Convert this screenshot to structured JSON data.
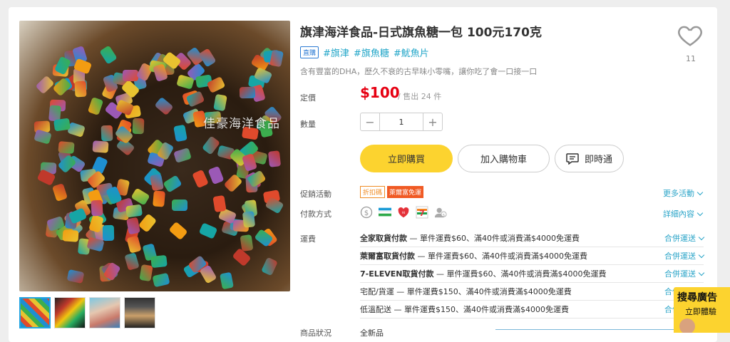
{
  "product": {
    "title": "旗津海洋食品-日式旗魚糖一包 100元170克",
    "badge": "直購",
    "hashtags": [
      "#旗津",
      "#旗魚糖",
      "#魷魚片"
    ],
    "description": "含有豐富的DHA，歷久不衰的古早味小零嘴，讓你吃了會一口接一口",
    "favorite_count": "11",
    "watermark": "佳豪海洋食品"
  },
  "price": {
    "label": "定價",
    "value": "$100",
    "sold": "/ 售出 24 件"
  },
  "quantity": {
    "label": "數量",
    "minus": "−",
    "value": "1",
    "plus": "+"
  },
  "actions": {
    "buy": "立即購買",
    "cart": "加入購物車",
    "chat": "即時通"
  },
  "promo": {
    "label": "促銷活動",
    "tags": [
      "折扣碼",
      "萊爾富免運"
    ],
    "more": "更多活動"
  },
  "payment": {
    "label": "付款方式",
    "icons": [
      "dollar-icon",
      "familymart-icon",
      "hilife-icon",
      "7-eleven-icon",
      "cash-on-delivery-icon"
    ],
    "more": "詳細內容"
  },
  "shipping": {
    "label": "運費",
    "rows": [
      {
        "name": "全家取貨付款",
        "detail": " — 單件運費$60、滿40件或消費滿$4000免運費",
        "link": "合併運送"
      },
      {
        "name": "萊爾富取貨付款",
        "detail": " — 單件運費$60、滿40件或消費滿$4000免運費",
        "link": "合併運送"
      },
      {
        "name": "7-ELEVEN取貨付款",
        "detail": " — 單件運費$60、滿40件或消費滿$4000免運費",
        "link": "合併運送"
      },
      {
        "name": "宅配/貨運",
        "detail": " — 單件運費$150、滿40件或消費滿$4000免運費",
        "link": "合併運送"
      },
      {
        "name": "低溫配送",
        "detail": " — 單件運費$150、滿40件或消費滿$4000免運費",
        "link": "合併運送"
      }
    ]
  },
  "condition": {
    "label": "商品狀況",
    "value": "全新品"
  },
  "ad": {
    "line1": "搜尋廣告",
    "line2": "立即體驗"
  },
  "colors": {
    "accent_yellow": "#fcd32f",
    "price_red": "#e60012",
    "link_blue": "#2aa4c8"
  }
}
